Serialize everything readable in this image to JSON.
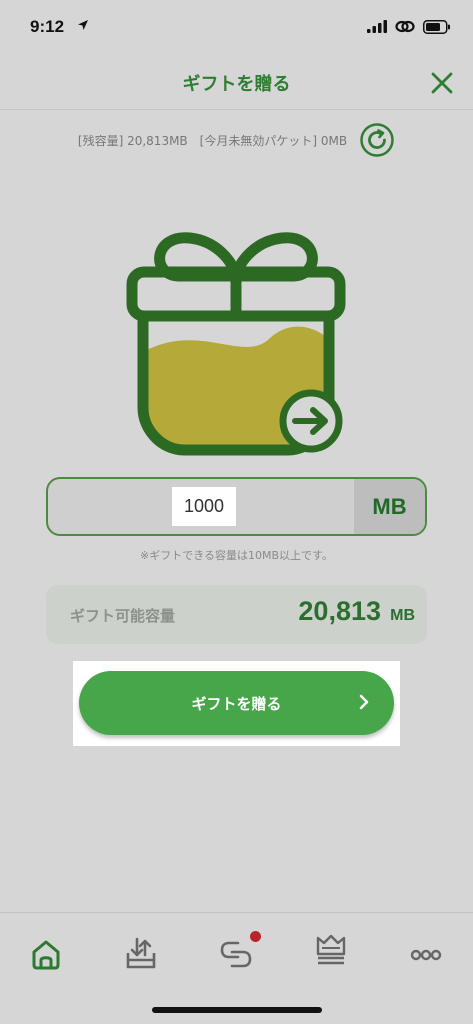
{
  "status_bar": {
    "time": "9:12"
  },
  "header": {
    "title": "ギフトを贈る"
  },
  "info": {
    "remaining_capacity": "[残容量] 20,813MB",
    "expired_packets": "[今月未無効パケット] 0MB"
  },
  "amount": {
    "value": "1000",
    "unit": "MB"
  },
  "note": "※ギフトできる容量は10MB以上です。",
  "capacity": {
    "label": "ギフト可能容量",
    "value": "20,813",
    "unit": "MB"
  },
  "cta": {
    "label": "ギフトを贈る"
  },
  "tabs": [
    "home-icon",
    "download-tray-icon",
    "chat-icon",
    "crown-icon",
    "more-icon"
  ],
  "colors": {
    "accent": "#47a54a",
    "brand_green": "#2f7d32",
    "badge": "#b8242c",
    "gift_fill": "#b5a93a"
  }
}
